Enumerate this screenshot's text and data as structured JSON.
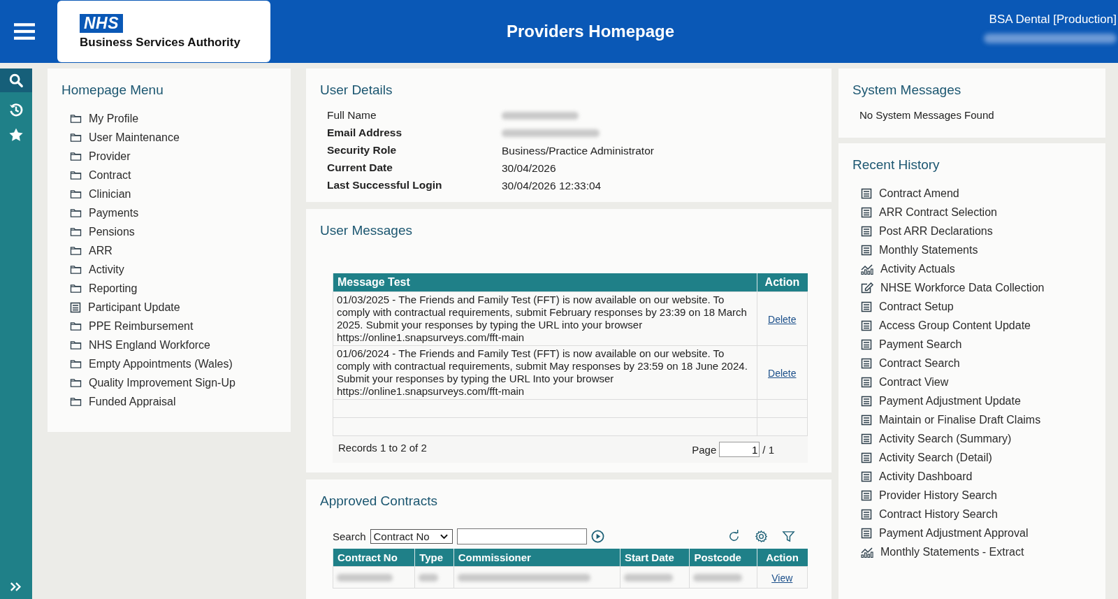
{
  "header": {
    "logo_mark": "NHS",
    "logo_text": "Business Services Authority",
    "title": "Providers Homepage",
    "environment": "BSA Dental [Production]"
  },
  "homepage_menu": {
    "title": "Homepage Menu",
    "items": [
      {
        "label": "My Profile",
        "kind": "folder"
      },
      {
        "label": "User Maintenance",
        "kind": "folder"
      },
      {
        "label": "Provider",
        "kind": "folder"
      },
      {
        "label": "Contract",
        "kind": "folder"
      },
      {
        "label": "Clinician",
        "kind": "folder"
      },
      {
        "label": "Payments",
        "kind": "folder"
      },
      {
        "label": "Pensions",
        "kind": "folder"
      },
      {
        "label": "ARR",
        "kind": "folder"
      },
      {
        "label": "Activity",
        "kind": "folder"
      },
      {
        "label": "Reporting",
        "kind": "folder"
      },
      {
        "label": "Participant Update",
        "kind": "form"
      },
      {
        "label": "PPE Reimbursement",
        "kind": "folder"
      },
      {
        "label": "NHS England Workforce",
        "kind": "folder"
      },
      {
        "label": "Empty Appointments (Wales)",
        "kind": "folder"
      },
      {
        "label": "Quality Improvement Sign-Up",
        "kind": "folder"
      },
      {
        "label": "Funded Appraisal",
        "kind": "folder"
      }
    ]
  },
  "user_details": {
    "title": "User Details",
    "rows": [
      {
        "label": "Full Name",
        "value": null,
        "bold": false
      },
      {
        "label": "Email Address",
        "value": null,
        "bold": true
      },
      {
        "label": "Security Role",
        "value": "Business/Practice Administrator",
        "bold": true
      },
      {
        "label": "Current Date",
        "value": "30/04/2026",
        "bold": true
      },
      {
        "label": "Last Successful Login",
        "value": "30/04/2026 12:33:04",
        "bold": true
      }
    ]
  },
  "user_messages": {
    "title": "User Messages",
    "columns": [
      "Message Test",
      "Action"
    ],
    "rows": [
      {
        "message": "01/03/2025 - The Friends and Family Test (FFT) is now available on our website. To comply with contractual requirements, submit February responses by 23:39 on 18 March 2025. Submit your responses by typing the URL into your browser https://online1.snapsurveys.com/fft-main",
        "action": "Delete"
      },
      {
        "message": "01/06/2024 - The Friends and Family Test (FFT) is now available on our website. To comply with contractual requirements, submit May responses by 23:59 on 18 June 2024. Submit your responses by typing the URL Into your browser https://online1.snapsurveys.com/fft-main",
        "action": "Delete"
      }
    ],
    "records": "Records 1 to 2 of 2",
    "page_label": "Page",
    "page_value": "1",
    "page_total": "/ 1"
  },
  "approved_contracts": {
    "title": "Approved Contracts",
    "search_label": "Search",
    "search_field": "Contract No",
    "columns": [
      "Contract No",
      "Type",
      "Commissioner",
      "Start Date",
      "Postcode",
      "Action"
    ],
    "rows": [
      {
        "action": "View"
      }
    ]
  },
  "system_messages": {
    "title": "System Messages",
    "text": "No System Messages Found"
  },
  "recent_history": {
    "title": "Recent History",
    "items": [
      {
        "label": "Contract Amend",
        "kind": "form"
      },
      {
        "label": "ARR Contract Selection",
        "kind": "form"
      },
      {
        "label": "Post ARR Declarations",
        "kind": "form"
      },
      {
        "label": "Monthly Statements",
        "kind": "form"
      },
      {
        "label": "Activity Actuals",
        "kind": "chart"
      },
      {
        "label": "NHSE Workforce Data Collection",
        "kind": "edit"
      },
      {
        "label": "Contract Setup",
        "kind": "form"
      },
      {
        "label": "Access Group Content Update",
        "kind": "form"
      },
      {
        "label": "Payment Search",
        "kind": "form"
      },
      {
        "label": "Contract Search",
        "kind": "form"
      },
      {
        "label": "Contract View",
        "kind": "form"
      },
      {
        "label": "Payment Adjustment Update",
        "kind": "form"
      },
      {
        "label": "Maintain or Finalise Draft Claims",
        "kind": "form"
      },
      {
        "label": "Activity Search (Summary)",
        "kind": "form"
      },
      {
        "label": "Activity Search (Detail)",
        "kind": "form"
      },
      {
        "label": "Activity Dashboard",
        "kind": "form"
      },
      {
        "label": "Provider History Search",
        "kind": "form"
      },
      {
        "label": "Contract History Search",
        "kind": "form"
      },
      {
        "label": "Payment Adjustment Approval",
        "kind": "form"
      },
      {
        "label": "Monthly Statements - Extract",
        "kind": "chart"
      }
    ]
  }
}
